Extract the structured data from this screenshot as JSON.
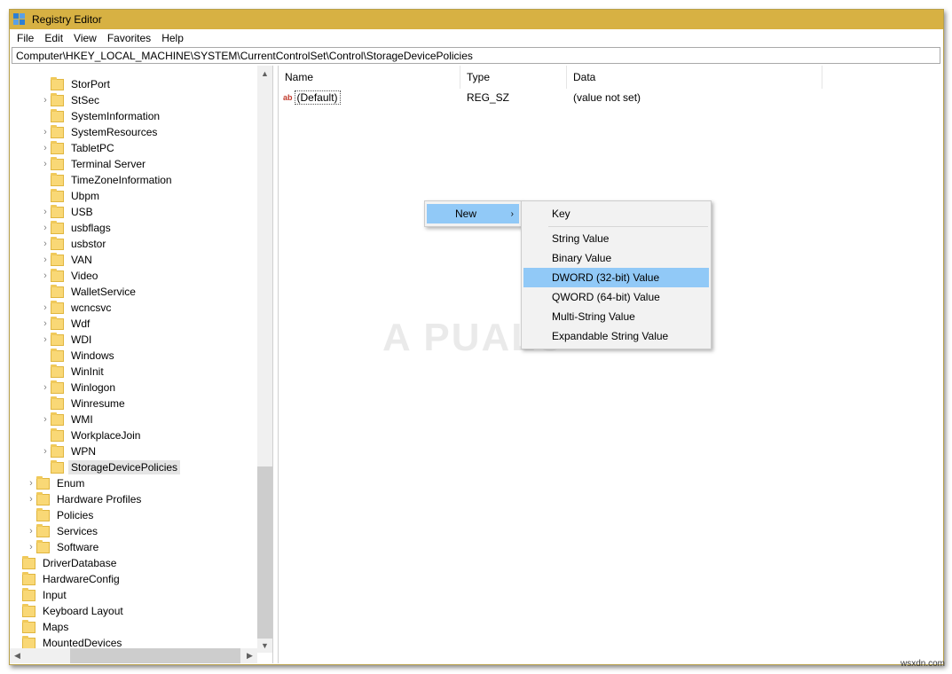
{
  "window": {
    "title": "Registry Editor"
  },
  "menu": {
    "file": "File",
    "edit": "Edit",
    "view": "View",
    "favorites": "Favorites",
    "help": "Help"
  },
  "address": "Computer\\HKEY_LOCAL_MACHINE\\SYSTEM\\CurrentControlSet\\Control\\StorageDevicePolicies",
  "tree": {
    "items": [
      {
        "label": "StorPort",
        "level": 2,
        "expand": false
      },
      {
        "label": "StSec",
        "level": 2,
        "expand": true
      },
      {
        "label": "SystemInformation",
        "level": 2,
        "expand": false
      },
      {
        "label": "SystemResources",
        "level": 2,
        "expand": true
      },
      {
        "label": "TabletPC",
        "level": 2,
        "expand": true
      },
      {
        "label": "Terminal Server",
        "level": 2,
        "expand": true
      },
      {
        "label": "TimeZoneInformation",
        "level": 2,
        "expand": false
      },
      {
        "label": "Ubpm",
        "level": 2,
        "expand": false
      },
      {
        "label": "USB",
        "level": 2,
        "expand": true
      },
      {
        "label": "usbflags",
        "level": 2,
        "expand": true
      },
      {
        "label": "usbstor",
        "level": 2,
        "expand": true
      },
      {
        "label": "VAN",
        "level": 2,
        "expand": true
      },
      {
        "label": "Video",
        "level": 2,
        "expand": true
      },
      {
        "label": "WalletService",
        "level": 2,
        "expand": false
      },
      {
        "label": "wcncsvc",
        "level": 2,
        "expand": true
      },
      {
        "label": "Wdf",
        "level": 2,
        "expand": true
      },
      {
        "label": "WDI",
        "level": 2,
        "expand": true
      },
      {
        "label": "Windows",
        "level": 2,
        "expand": false
      },
      {
        "label": "WinInit",
        "level": 2,
        "expand": false
      },
      {
        "label": "Winlogon",
        "level": 2,
        "expand": true
      },
      {
        "label": "Winresume",
        "level": 2,
        "expand": false
      },
      {
        "label": "WMI",
        "level": 2,
        "expand": true
      },
      {
        "label": "WorkplaceJoin",
        "level": 2,
        "expand": false
      },
      {
        "label": "WPN",
        "level": 2,
        "expand": true
      },
      {
        "label": "StorageDevicePolicies",
        "level": 2,
        "expand": false,
        "selected": true
      },
      {
        "label": "Enum",
        "level": 1,
        "expand": true
      },
      {
        "label": "Hardware Profiles",
        "level": 1,
        "expand": true
      },
      {
        "label": "Policies",
        "level": 1,
        "expand": false
      },
      {
        "label": "Services",
        "level": 1,
        "expand": true
      },
      {
        "label": "Software",
        "level": 1,
        "expand": true
      },
      {
        "label": "DriverDatabase",
        "level": 0,
        "expand": false
      },
      {
        "label": "HardwareConfig",
        "level": 0,
        "expand": false
      },
      {
        "label": "Input",
        "level": 0,
        "expand": false
      },
      {
        "label": "Keyboard Layout",
        "level": 0,
        "expand": false
      },
      {
        "label": "Maps",
        "level": 0,
        "expand": false
      },
      {
        "label": "MountedDevices",
        "level": 0,
        "expand": false
      }
    ]
  },
  "list": {
    "headers": {
      "name": "Name",
      "type": "Type",
      "data": "Data"
    },
    "rows": [
      {
        "name": "(Default)",
        "type": "REG_SZ",
        "data": "(value not set)"
      }
    ]
  },
  "context_menu": {
    "new_label": "New",
    "submenu": {
      "key": "Key",
      "items": [
        "String Value",
        "Binary Value",
        "DWORD (32-bit) Value",
        "QWORD (64-bit) Value",
        "Multi-String Value",
        "Expandable String Value"
      ],
      "highlighted": "DWORD (32-bit) Value"
    }
  },
  "watermark": "A PUALS",
  "credit": "wsxdn.com",
  "colors": {
    "titlebar": "#d7b143",
    "highlight": "#91c9f7",
    "folder": "#f9d876"
  }
}
